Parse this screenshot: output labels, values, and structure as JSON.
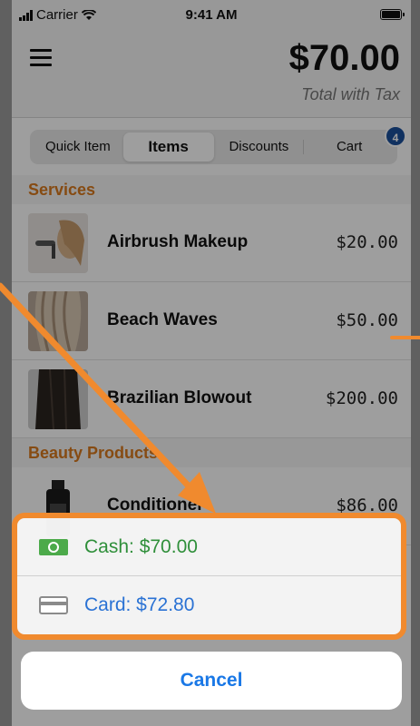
{
  "status": {
    "carrier": "Carrier",
    "time": "9:41 AM"
  },
  "header": {
    "total": "$70.00",
    "total_label": "Total with Tax"
  },
  "segments": [
    {
      "label": "Quick Item"
    },
    {
      "label": "Items"
    },
    {
      "label": "Discounts"
    },
    {
      "label": "Cart"
    }
  ],
  "cart_badge": "4",
  "sections": {
    "services": "Services",
    "beauty": "Beauty Products"
  },
  "items": [
    {
      "name": "Airbrush Makeup",
      "price": "$20.00"
    },
    {
      "name": "Beach Waves",
      "price": "$50.00"
    },
    {
      "name": "Brazilian Blowout",
      "price": "$200.00"
    },
    {
      "name": "Conditioner",
      "price": "$86.00"
    }
  ],
  "sheet": {
    "cash": "Cash: $70.00",
    "card": "Card: $72.80",
    "cancel": "Cancel"
  },
  "colors": {
    "accent_orange": "#f08a2e",
    "section_orange": "#d9791e",
    "cash_green": "#2f8f3a",
    "card_blue": "#2a72d4",
    "cancel_blue": "#1a78e6",
    "badge_blue": "#1b4f9c"
  },
  "icons": [
    "signal-icon",
    "wifi-icon",
    "battery-icon",
    "menu-icon",
    "cash-icon",
    "card-icon"
  ]
}
